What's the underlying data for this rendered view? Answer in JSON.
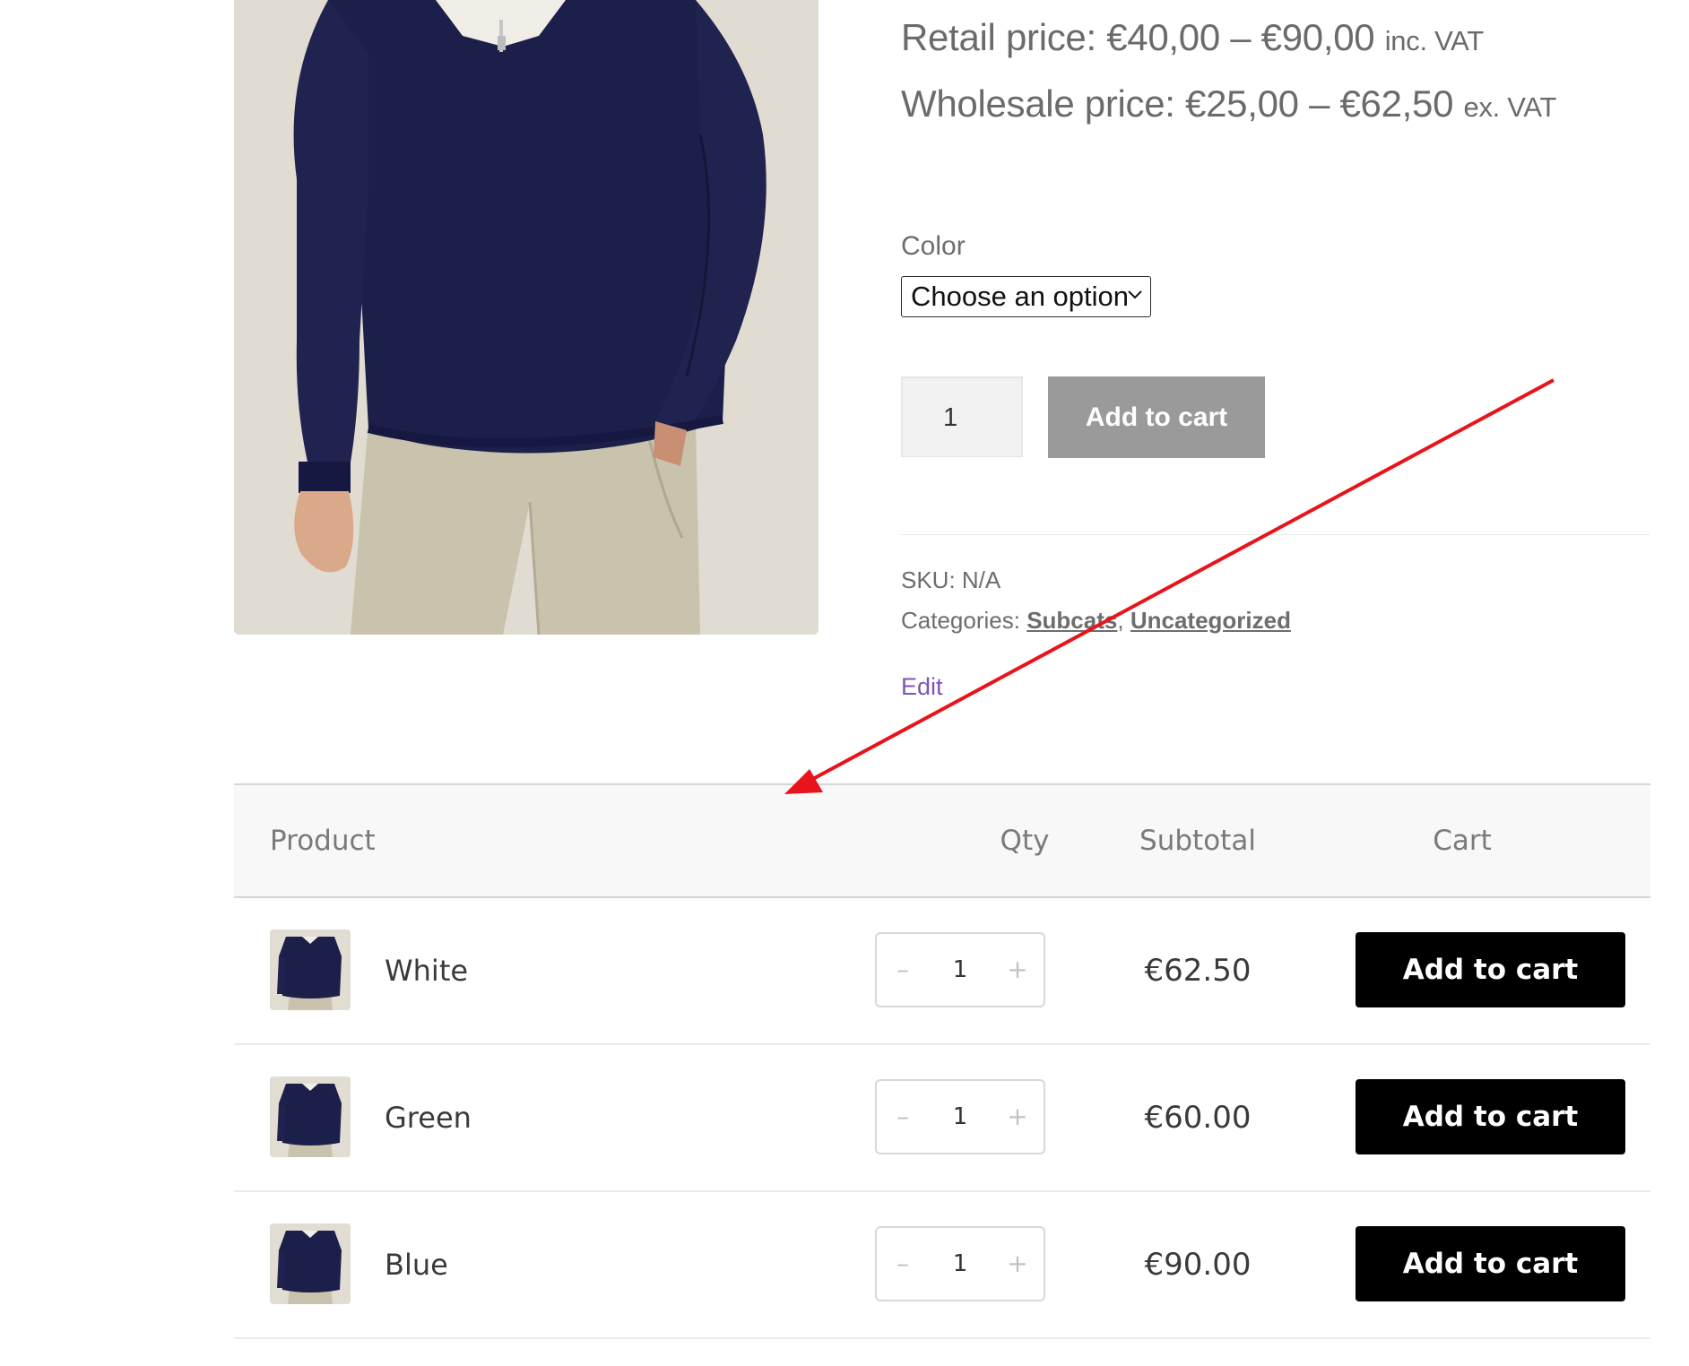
{
  "product": {
    "retail_price": {
      "label": "Retail price: €40,00 – €90,00",
      "suffix": "inc. VAT"
    },
    "wholesale_price": {
      "label": "Wholesale price: €25,00 – €62,50",
      "suffix": "ex. VAT"
    },
    "color_label": "Color",
    "color_select": {
      "selected": "Choose an option"
    },
    "quantity": "1",
    "add_to_cart_label": "Add to cart",
    "sku_label": "SKU: N/A",
    "categories_label": "Categories:",
    "categories": [
      "Subcats",
      "Uncategorized"
    ],
    "category_separator": ",",
    "edit_label": "Edit"
  },
  "variations_table": {
    "headers": {
      "product": "Product",
      "qty": "Qty",
      "subtotal": "Subtotal",
      "cart": "Cart"
    },
    "rows": [
      {
        "name": "White",
        "qty": "1",
        "subtotal": "€62.50",
        "button": "Add to cart",
        "minus": "–",
        "plus": "+"
      },
      {
        "name": "Green",
        "qty": "1",
        "subtotal": "€60.00",
        "button": "Add to cart",
        "minus": "–",
        "plus": "+"
      },
      {
        "name": "Blue",
        "qty": "1",
        "subtotal": "€90.00",
        "button": "Add to cart",
        "minus": "–",
        "plus": "+"
      }
    ]
  },
  "colors": {
    "sweater": "#1c1f4a",
    "chinos": "#c9c2ad",
    "annotation_arrow": "#e8131b",
    "edit_link": "#7f54b3",
    "gray_button": "#9a9a9a",
    "black_button": "#000000"
  }
}
